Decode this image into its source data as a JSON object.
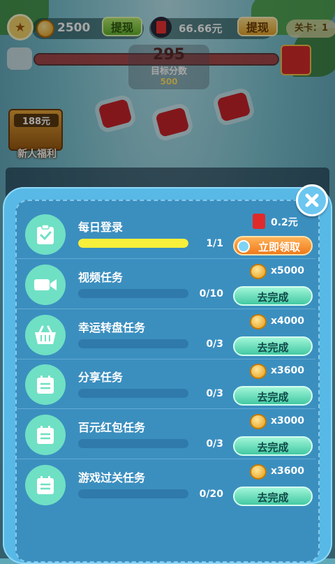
{
  "header": {
    "coins": "2500",
    "withdraw_label": "提现",
    "money": "66.66元",
    "withdraw_label_2": "提现",
    "level": "关卡：1"
  },
  "score": {
    "value": "295",
    "label": "目标分数",
    "target": "500"
  },
  "newbie": {
    "price": "188元",
    "label": "新人福利"
  },
  "tasks": [
    {
      "title": "每日登录",
      "progress_text": "1/1",
      "progress": 1.0,
      "reward_type": "redpacket",
      "reward": "0.2元",
      "action": "立即领取",
      "icon": "clipboard-check-icon"
    },
    {
      "title": "视频任务",
      "progress_text": "0/10",
      "progress": 0,
      "reward_type": "coin",
      "reward": "x5000",
      "action": "去完成",
      "icon": "video-camera-icon"
    },
    {
      "title": "幸运转盘任务",
      "progress_text": "0/3",
      "progress": 0,
      "reward_type": "coin",
      "reward": "x4000",
      "action": "去完成",
      "icon": "basket-icon"
    },
    {
      "title": "分享任务",
      "progress_text": "0/3",
      "progress": 0,
      "reward_type": "coin",
      "reward": "x3600",
      "action": "去完成",
      "icon": "calendar-icon"
    },
    {
      "title": "百元红包任务",
      "progress_text": "0/3",
      "progress": 0,
      "reward_type": "coin",
      "reward": "x3000",
      "action": "去完成",
      "icon": "calendar-icon"
    },
    {
      "title": "游戏过关任务",
      "progress_text": "0/20",
      "progress": 0,
      "reward_type": "coin",
      "reward": "x3600",
      "action": "去完成",
      "icon": "calendar-icon"
    }
  ]
}
